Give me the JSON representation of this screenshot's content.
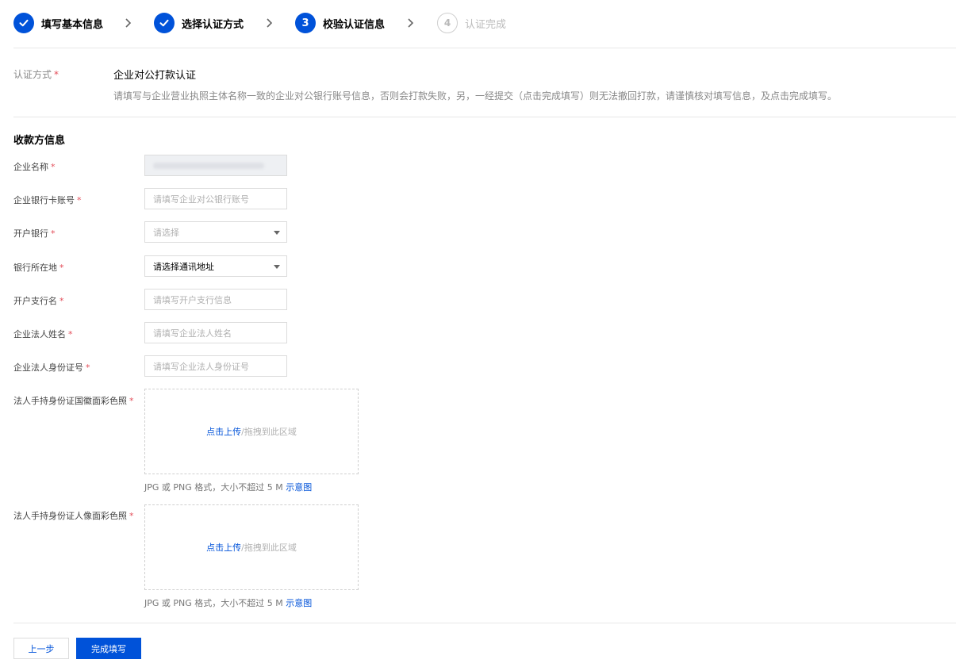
{
  "steps": [
    {
      "label": "填写基本信息",
      "state": "done"
    },
    {
      "label": "选择认证方式",
      "state": "done"
    },
    {
      "label": "校验认证信息",
      "state": "active",
      "number": "3"
    },
    {
      "label": "认证完成",
      "state": "pending",
      "number": "4"
    }
  ],
  "auth": {
    "label": "认证方式",
    "required": "*",
    "value": "企业对公打款认证",
    "description": "请填写与企业营业执照主体名称一致的企业对公银行账号信息，否则会打款失败，另，一经提交（点击完成填写）则无法撤回打款，请谨慎核对填写信息，及点击完成填写。"
  },
  "section_title": "收款方信息",
  "fields": {
    "company_name": {
      "label": "企业名称",
      "required": "*"
    },
    "bank_account": {
      "label": "企业银行卡账号",
      "required": "*",
      "placeholder": "请填写企业对公银行账号"
    },
    "bank": {
      "label": "开户银行",
      "required": "*",
      "placeholder": "请选择"
    },
    "bank_location": {
      "label": "银行所在地",
      "required": "*",
      "value": "请选择通讯地址"
    },
    "branch": {
      "label": "开户支行名",
      "required": "*",
      "placeholder": "请填写开户支行信息"
    },
    "legal_name": {
      "label": "企业法人姓名",
      "required": "*",
      "placeholder": "请填写企业法人姓名"
    },
    "legal_id": {
      "label": "企业法人身份证号",
      "required": "*",
      "placeholder": "请填写企业法人身份证号"
    }
  },
  "uploads": {
    "emblem": {
      "label": "法人手持身份证国徽面彩色照",
      "required": "*",
      "link": "点击上传",
      "hint": "/拖拽到此区域",
      "tip": "JPG 或 PNG 格式，大小不超过 5 M",
      "tip_link": "示意图"
    },
    "portrait": {
      "label": "法人手持身份证人像面彩色照",
      "required": "*",
      "link": "点击上传",
      "hint": "/拖拽到此区域",
      "tip": "JPG 或 PNG 格式，大小不超过 5 M",
      "tip_link": "示意图"
    }
  },
  "buttons": {
    "prev": "上一步",
    "submit": "完成填写"
  },
  "colors": {
    "primary": "#0052d9",
    "required": "#e34d59"
  }
}
